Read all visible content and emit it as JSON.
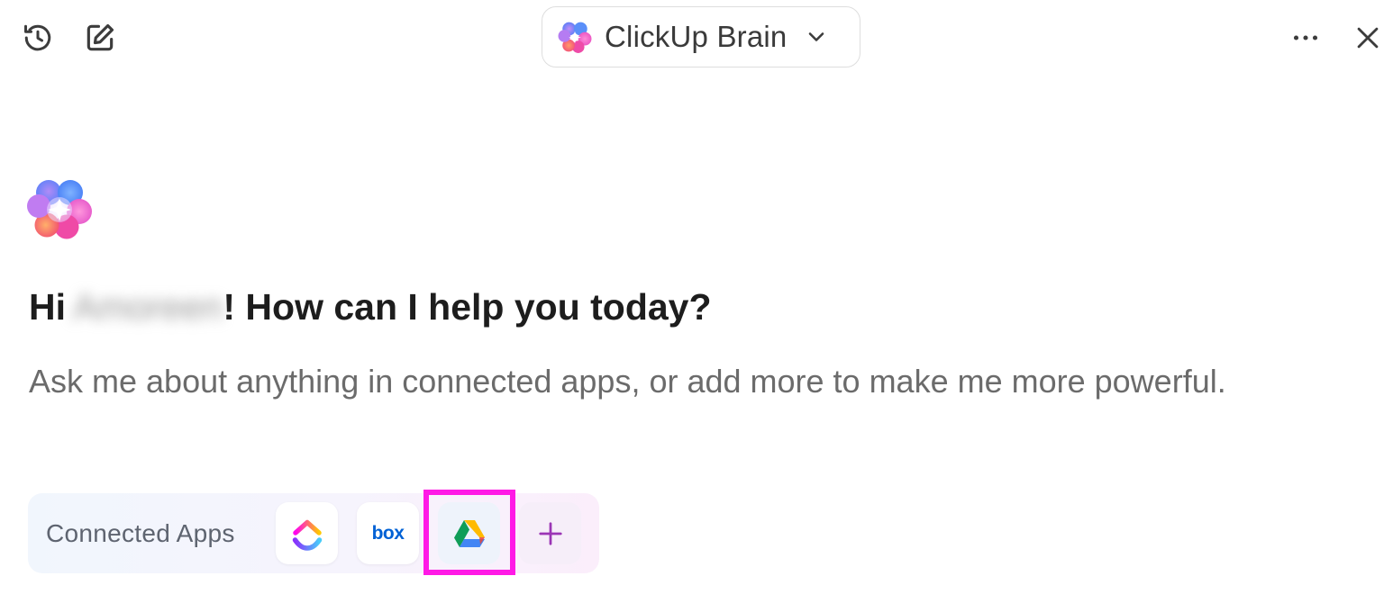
{
  "header": {
    "model_name": "ClickUp Brain",
    "icons": {
      "history": "history-icon",
      "new_chat": "compose-icon",
      "more": "more-horizontal-icon",
      "close": "close-icon",
      "dropdown": "chevron-down-icon"
    }
  },
  "hero": {
    "greeting_prefix": "Hi",
    "user_name": "Amoreen",
    "greeting_suffix": "! How can I help you today?",
    "subtitle": "Ask me about anything in connected apps, or add more to make me more powerful."
  },
  "connected_apps": {
    "label": "Connected Apps",
    "apps": [
      {
        "name": "ClickUp",
        "icon": "clickup-logo-icon"
      },
      {
        "name": "Box",
        "icon": "box-logo-icon",
        "logo_text": "box"
      },
      {
        "name": "Google Drive",
        "icon": "google-drive-logo-icon"
      }
    ],
    "add_icon": "plus-icon"
  },
  "colors": {
    "highlight": "#ff19e6",
    "box_brand": "#0061d5",
    "add_accent": "#9b35b5"
  }
}
